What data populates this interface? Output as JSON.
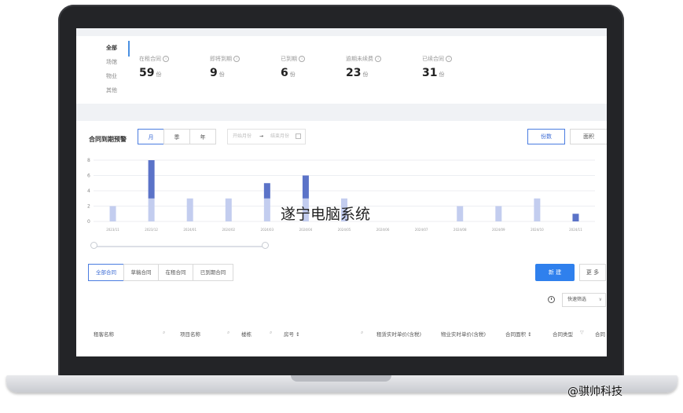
{
  "categories": [
    "全部",
    "场馆",
    "物业",
    "其他"
  ],
  "stats": [
    {
      "label": "在租合同",
      "value": "59",
      "unit": "份"
    },
    {
      "label": "即将到期",
      "value": "9",
      "unit": "份"
    },
    {
      "label": "已到期",
      "value": "6",
      "unit": "份"
    },
    {
      "label": "逾期未续费",
      "value": "23",
      "unit": "份"
    },
    {
      "label": "已续合同",
      "value": "31",
      "unit": "份"
    }
  ],
  "chart_header": {
    "title": "合同到期预警",
    "periods": [
      "月",
      "季",
      "年"
    ],
    "active_period": "月",
    "date_start_placeholder": "开始月份",
    "date_arrow": "→",
    "date_end_placeholder": "结束月份",
    "calendar_icon": "calendar-icon",
    "metric_toggle": [
      "份数",
      "面积"
    ],
    "active_metric": "份数"
  },
  "chart_data": {
    "type": "bar",
    "categories": [
      "2023/11",
      "2023/12",
      "2024/01",
      "2024/02",
      "2024/03",
      "2024/04",
      "2024/05",
      "2024/06",
      "2024/07",
      "2024/08",
      "2024/09",
      "2024/10",
      "2024/11"
    ],
    "series": [
      {
        "name": "",
        "values": [
          2,
          3,
          3,
          3,
          3,
          3,
          3,
          0,
          0,
          2,
          2,
          3,
          0
        ],
        "color": "#c3cdef"
      },
      {
        "name": "",
        "values": [
          0,
          5,
          0,
          0,
          2,
          3,
          0,
          0,
          0,
          0,
          0,
          0,
          1
        ],
        "color": "#5b73c8"
      }
    ],
    "stacked": true,
    "y_ticks": [
      0,
      2,
      4,
      6,
      8
    ],
    "ylim": [
      0,
      8
    ],
    "grid": true
  },
  "watermark_center": "遂宁电脑系统",
  "contract_tabs": [
    "全部合同",
    "草稿合同",
    "在租合同",
    "已到期合同"
  ],
  "active_contract_tab": "全部合同",
  "actions": {
    "new_label": "新 建",
    "more_label": "更 多"
  },
  "quick_filter": {
    "label": "快速筛选",
    "icon": "clock-icon"
  },
  "table_headers": [
    {
      "label": "租客名称",
      "icon": "search-icon"
    },
    {
      "label": "项目名称",
      "icon": "search-icon"
    },
    {
      "label": "楼栋",
      "icon": "search-icon"
    },
    {
      "label": "房号 ↕",
      "icon": "search-icon"
    },
    {
      "label": "租赁实时单价(含税)"
    },
    {
      "label": "物业实时单价(含税)"
    },
    {
      "label": "合同面积 ↕"
    },
    {
      "label": "合同类型",
      "icon": "filter-icon"
    },
    {
      "label": "合同"
    }
  ],
  "corner_watermark": "@骐帅科技",
  "colors": {
    "accent": "#2f80ed",
    "bar_light": "#c3cdef",
    "bar_dark": "#5b73c8"
  }
}
